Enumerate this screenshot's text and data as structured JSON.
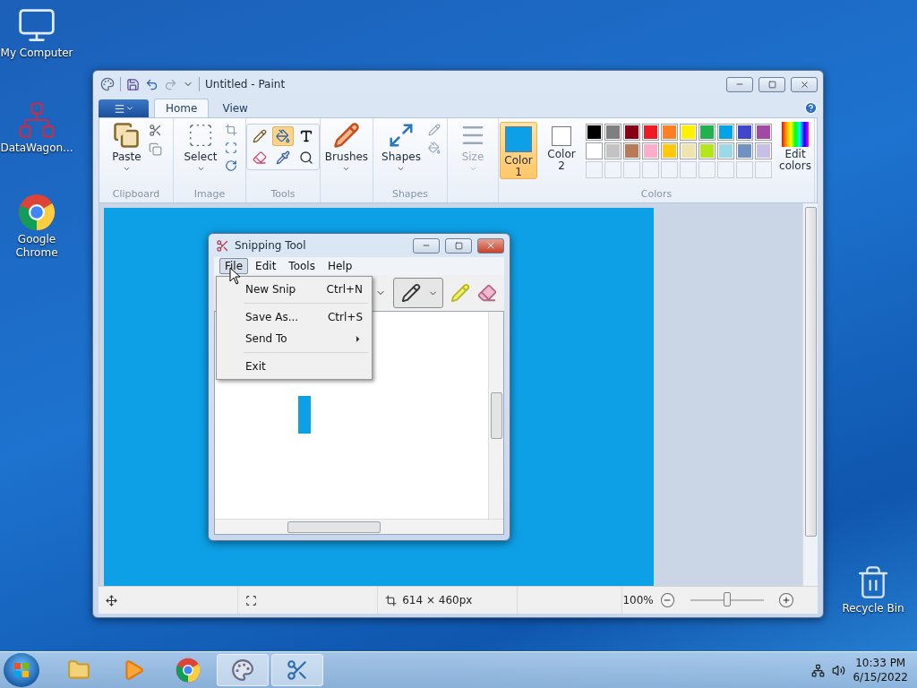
{
  "desktop_icons": [
    {
      "label": "My Computer",
      "kind": "computer"
    },
    {
      "label": "DataWagon...",
      "kind": "network"
    },
    {
      "label": "Google Chrome",
      "kind": "chrome"
    }
  ],
  "recycle_bin": {
    "label": "Recycle Bin"
  },
  "paint": {
    "title": "Untitled - Paint",
    "tabs": [
      {
        "label": "Home",
        "selected": true
      },
      {
        "label": "View",
        "selected": false
      }
    ],
    "clipboard": {
      "paste": "Paste",
      "group": "Clipboard"
    },
    "image": {
      "select": "Select",
      "group": "Image"
    },
    "tools": {
      "group": "Tools",
      "items": [
        {
          "kind": "pencil",
          "selected": false
        },
        {
          "kind": "fill",
          "selected": true
        },
        {
          "kind": "text",
          "selected": false
        },
        {
          "kind": "eraser",
          "selected": false
        },
        {
          "kind": "picker",
          "selected": false
        },
        {
          "kind": "magnifier",
          "selected": false
        }
      ]
    },
    "brushes": {
      "label": "Brushes"
    },
    "shapes": {
      "label": "Shapes",
      "group": "Shapes"
    },
    "size": {
      "label": "Size",
      "disabled": true
    },
    "colors": {
      "group": "Colors",
      "edit": "Edit colors",
      "slots": [
        {
          "label": "Color",
          "number": "1",
          "color": "#0ea0e6",
          "selected": true
        },
        {
          "label": "Color",
          "number": "2",
          "color": "#ffffff",
          "selected": false
        }
      ],
      "palette": [
        {
          "color": "#000000"
        },
        {
          "color": "#7f7f7f"
        },
        {
          "color": "#880015"
        },
        {
          "color": "#ed1c24"
        },
        {
          "color": "#ff7f27"
        },
        {
          "color": "#fff200"
        },
        {
          "color": "#22b14c"
        },
        {
          "color": "#00a2e8"
        },
        {
          "color": "#3f48cc"
        },
        {
          "color": "#a349a4"
        },
        {
          "color": "#ffffff"
        },
        {
          "color": "#c3c3c3"
        },
        {
          "color": "#b97a57"
        },
        {
          "color": "#ffaec9"
        },
        {
          "color": "#ffc90e"
        },
        {
          "color": "#efe4b0"
        },
        {
          "color": "#b5e61d"
        },
        {
          "color": "#99d9ea"
        },
        {
          "color": "#7092be"
        },
        {
          "color": "#c8bfe7"
        }
      ]
    },
    "canvas": {
      "color": "#0ea0e6"
    },
    "status": {
      "size": "614 × 460px",
      "zoom": "100%",
      "zoom_slider": {
        "level": 0.5
      }
    }
  },
  "snipping": {
    "title": "Snipping Tool",
    "menu": [
      {
        "label": "File",
        "selected": true
      },
      {
        "label": "Edit",
        "selected": false
      },
      {
        "label": "Tools",
        "selected": false
      },
      {
        "label": "Help",
        "selected": false
      }
    ],
    "file_menu": [
      {
        "kind": "item",
        "label": "New Snip",
        "shortcut": "Ctrl+N"
      },
      {
        "kind": "separator"
      },
      {
        "kind": "item",
        "label": "Save As...",
        "shortcut": "Ctrl+S"
      },
      {
        "kind": "submenu",
        "label": "Send To"
      },
      {
        "kind": "separator"
      },
      {
        "kind": "item",
        "label": "Exit"
      }
    ]
  },
  "taskbar": {
    "apps": [
      {
        "kind": "explorer",
        "open": false
      },
      {
        "kind": "media",
        "open": false
      },
      {
        "kind": "chrome",
        "open": false
      },
      {
        "kind": "paint",
        "open": true
      },
      {
        "kind": "snip",
        "open": true
      }
    ],
    "time": "10:33 PM",
    "date": "6/15/2022"
  }
}
